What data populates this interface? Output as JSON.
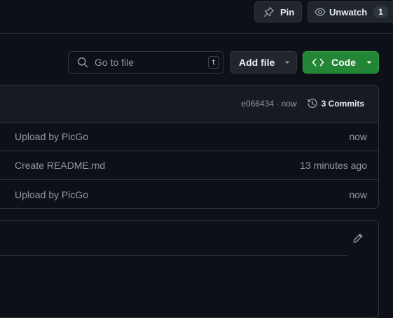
{
  "header": {
    "pin_label": "Pin",
    "unwatch_label": "Unwatch",
    "watch_count": "1"
  },
  "toolbar": {
    "search_placeholder": "Go to file",
    "search_shortcut": "t",
    "add_file_label": "Add file",
    "code_label": "Code"
  },
  "latest_commit": {
    "hash": "e066434",
    "separator": " · ",
    "time": "now",
    "commits_label": "3 Commits"
  },
  "files": [
    {
      "message": "Upload by PicGo",
      "time": "now"
    },
    {
      "message": "Create README.md",
      "time": "13 minutes ago"
    },
    {
      "message": "Upload by PicGo",
      "time": "now"
    }
  ],
  "colors": {
    "background": "#0d1117",
    "border": "#30363d",
    "primary_button": "#238636",
    "muted_text": "#9198a1"
  },
  "icons": {
    "pin": "pin-icon",
    "watch": "eye-icon",
    "search": "search-icon",
    "code": "code-icon",
    "history": "history-icon",
    "edit": "pencil-icon"
  }
}
